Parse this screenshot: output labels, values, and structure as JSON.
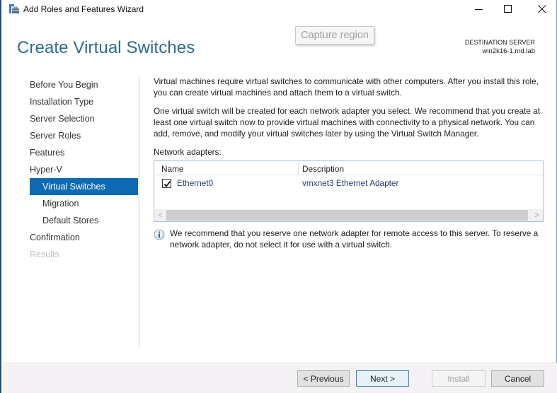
{
  "window": {
    "title": "Add Roles and Features Wizard",
    "controls": {
      "minimize": "minimize",
      "maximize": "maximize",
      "close": "close"
    }
  },
  "overlay": {
    "capture_label": "Capture region"
  },
  "header": {
    "page_title": "Create Virtual Switches",
    "destination_label": "DESTINATION SERVER",
    "destination_server": "win2k16-1.md.lab"
  },
  "nav": {
    "items": [
      {
        "label": "Before You Begin",
        "level": 0,
        "state": "normal"
      },
      {
        "label": "Installation Type",
        "level": 0,
        "state": "normal"
      },
      {
        "label": "Server Selection",
        "level": 0,
        "state": "normal"
      },
      {
        "label": "Server Roles",
        "level": 0,
        "state": "normal"
      },
      {
        "label": "Features",
        "level": 0,
        "state": "normal"
      },
      {
        "label": "Hyper-V",
        "level": 0,
        "state": "normal"
      },
      {
        "label": "Virtual Switches",
        "level": 1,
        "state": "active"
      },
      {
        "label": "Migration",
        "level": 1,
        "state": "normal"
      },
      {
        "label": "Default Stores",
        "level": 1,
        "state": "normal"
      },
      {
        "label": "Confirmation",
        "level": 0,
        "state": "normal"
      },
      {
        "label": "Results",
        "level": 0,
        "state": "disabled"
      }
    ]
  },
  "content": {
    "para1": "Virtual machines require virtual switches to communicate with other computers. After you install this role, you can create virtual machines and attach them to a virtual switch.",
    "para2": "One virtual switch will be created for each network adapter you select. We recommend that you create at least one virtual switch now to provide virtual machines with connectivity to a physical network. You can add, remove, and modify your virtual switches later by using the Virtual Switch Manager.",
    "adapters_label": "Network adapters:",
    "table": {
      "columns": [
        "Name",
        "Description"
      ],
      "rows": [
        {
          "checked": true,
          "name": "Ethernet0",
          "description": "vmxnet3 Ethernet Adapter"
        }
      ],
      "scroll_left": "<",
      "scroll_right": ">"
    },
    "info_text": "We recommend that you reserve one network adapter for remote access to this server. To reserve a network adapter, do not select it for use with a virtual switch."
  },
  "footer": {
    "previous": "< Previous",
    "next": "Next >",
    "install": "Install",
    "cancel": "Cancel"
  },
  "colors": {
    "accent": "#0f6ab4",
    "title": "#2c6b8f",
    "link_text": "#1f3f6e"
  }
}
